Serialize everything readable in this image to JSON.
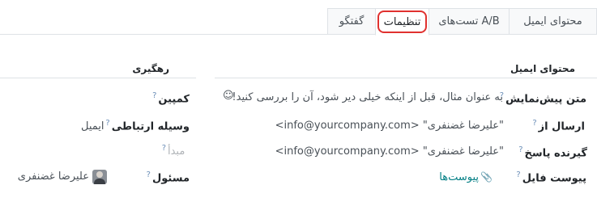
{
  "tabs": [
    {
      "label": "محتوای ایمیل",
      "active": false
    },
    {
      "label": "تست‌های A/B",
      "active": false
    },
    {
      "label": "تنظیمات",
      "active": true
    },
    {
      "label": "گفتگو",
      "active": false
    }
  ],
  "email_section": {
    "title": "محتوای ایمیل",
    "preview_label": "متن پیش‌نمایش",
    "preview_value": "به عنوان مثال، قبل از اینکه خیلی دیر شود، آن را بررسی کنید!",
    "send_from_label": "ارسال از",
    "send_from_value": "\"علیرضا غضنفری\" <info@yourcompany.com>",
    "reply_to_label": "گیرنده پاسخ",
    "reply_to_value": "\"علیرضا غضنفری\" <info@yourcompany.com>",
    "attachment_label": "پیوست فایل",
    "attachment_value": "پیوست‌ها",
    "help_mark": "?",
    "emoji_icon": "smile-icon",
    "attachment_icon": "paperclip-icon"
  },
  "tracking_section": {
    "title": "رهگیری",
    "campaign_label": "کمپین",
    "medium_label": "وسیله ارتباطی",
    "medium_value": "ایمیل",
    "source_label": "مبدأ",
    "responsible_label": "مسئول",
    "responsible_value": "علیرضا غضنفری"
  },
  "colors": {
    "active_tab_ring": "#e0312f",
    "link": "#017e84",
    "help": "#6c8fb8"
  }
}
